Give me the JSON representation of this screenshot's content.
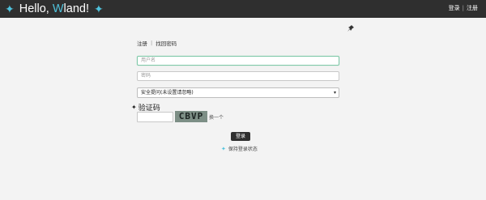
{
  "header": {
    "logo": {
      "part1": "Hello, ",
      "accent_letter": "W",
      "part2": "land!"
    },
    "links": {
      "login": "登录",
      "separator": "|",
      "register": "注册"
    }
  },
  "form": {
    "tabs": {
      "register": "注册",
      "separator": "|",
      "forgot_password": "找回密码"
    },
    "username": {
      "placeholder": "用户名",
      "value": ""
    },
    "password": {
      "placeholder": "密码",
      "value": ""
    },
    "security_question": {
      "selected": "安全提问(未设置请忽略)"
    },
    "captcha": {
      "title": "验证码",
      "image_text": "CBVP",
      "refresh_label": "换一个",
      "value": ""
    },
    "login_button": "登录",
    "remember_me": "保持登录状态"
  },
  "colors": {
    "topbar": "#2f2f2f",
    "accent": "#4fc3dd",
    "background": "#f3f3f3"
  },
  "icons": [
    "sparkle-icon",
    "pin-icon",
    "star-icon",
    "chevron-down-icon"
  ]
}
